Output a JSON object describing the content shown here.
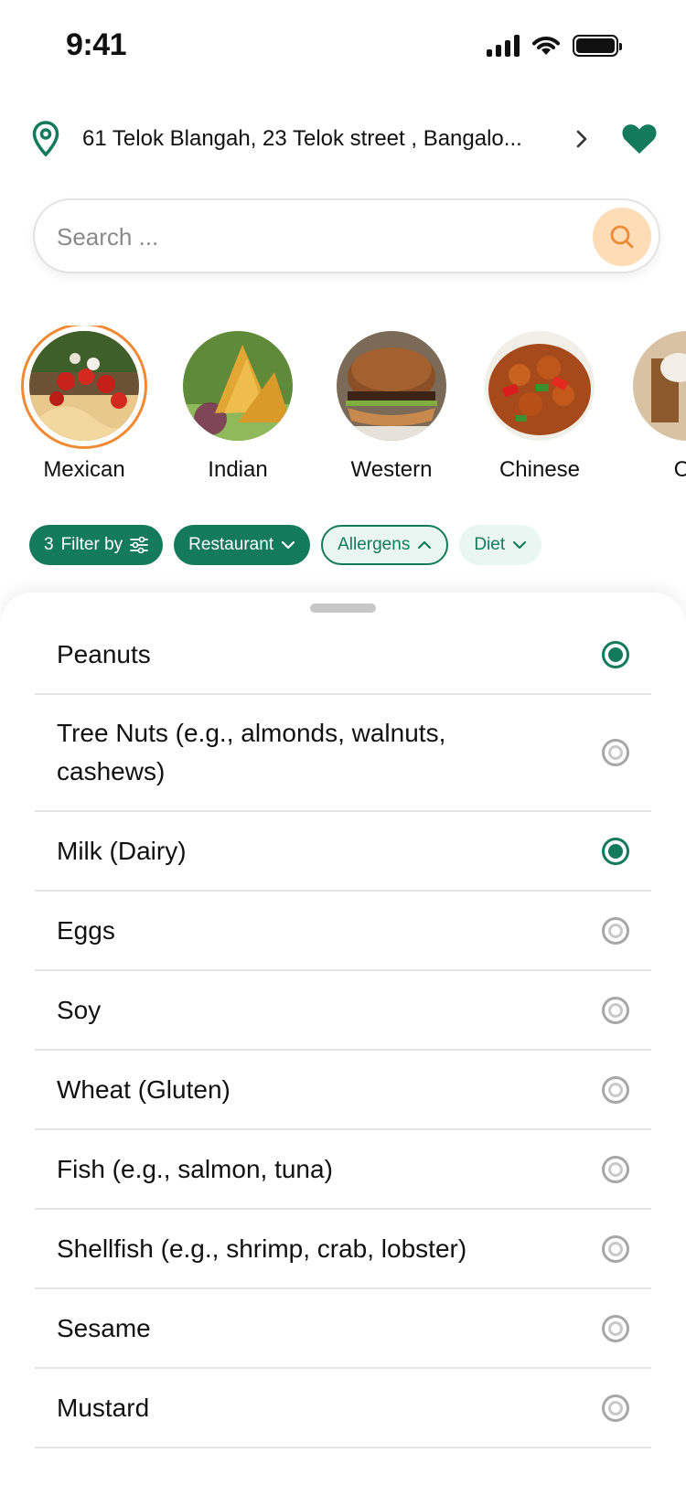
{
  "status_bar": {
    "time": "9:41"
  },
  "location": {
    "address": "61 Telok Blangah, 23 Telok street , Bangalo..."
  },
  "search": {
    "placeholder": "Search ..."
  },
  "categories": [
    {
      "label": "Mexican",
      "selected": true
    },
    {
      "label": "Indian",
      "selected": false
    },
    {
      "label": "Western",
      "selected": false
    },
    {
      "label": "Chinese",
      "selected": false
    },
    {
      "label": "Co",
      "selected": false
    }
  ],
  "filters": {
    "filter_count": "3",
    "filter_label": "Filter by",
    "restaurant_label": "Restaurant",
    "allergens_label": "Allergens",
    "diet_label": "Diet"
  },
  "allergens": [
    {
      "label": "Peanuts",
      "selected": true
    },
    {
      "label": "Tree Nuts (e.g., almonds, walnuts, cashews)",
      "selected": false
    },
    {
      "label": "Milk (Dairy)",
      "selected": true
    },
    {
      "label": "Eggs",
      "selected": false
    },
    {
      "label": "Soy",
      "selected": false
    },
    {
      "label": "Wheat (Gluten)",
      "selected": false
    },
    {
      "label": "Fish (e.g., salmon, tuna)",
      "selected": false
    },
    {
      "label": "Shellfish (e.g., shrimp, crab, lobster)",
      "selected": false
    },
    {
      "label": "Sesame",
      "selected": false
    },
    {
      "label": "Mustard",
      "selected": false
    }
  ],
  "colors": {
    "brand_green": "#137a5a",
    "accent_orange": "#f08a32",
    "search_button": "#fddcb6"
  }
}
